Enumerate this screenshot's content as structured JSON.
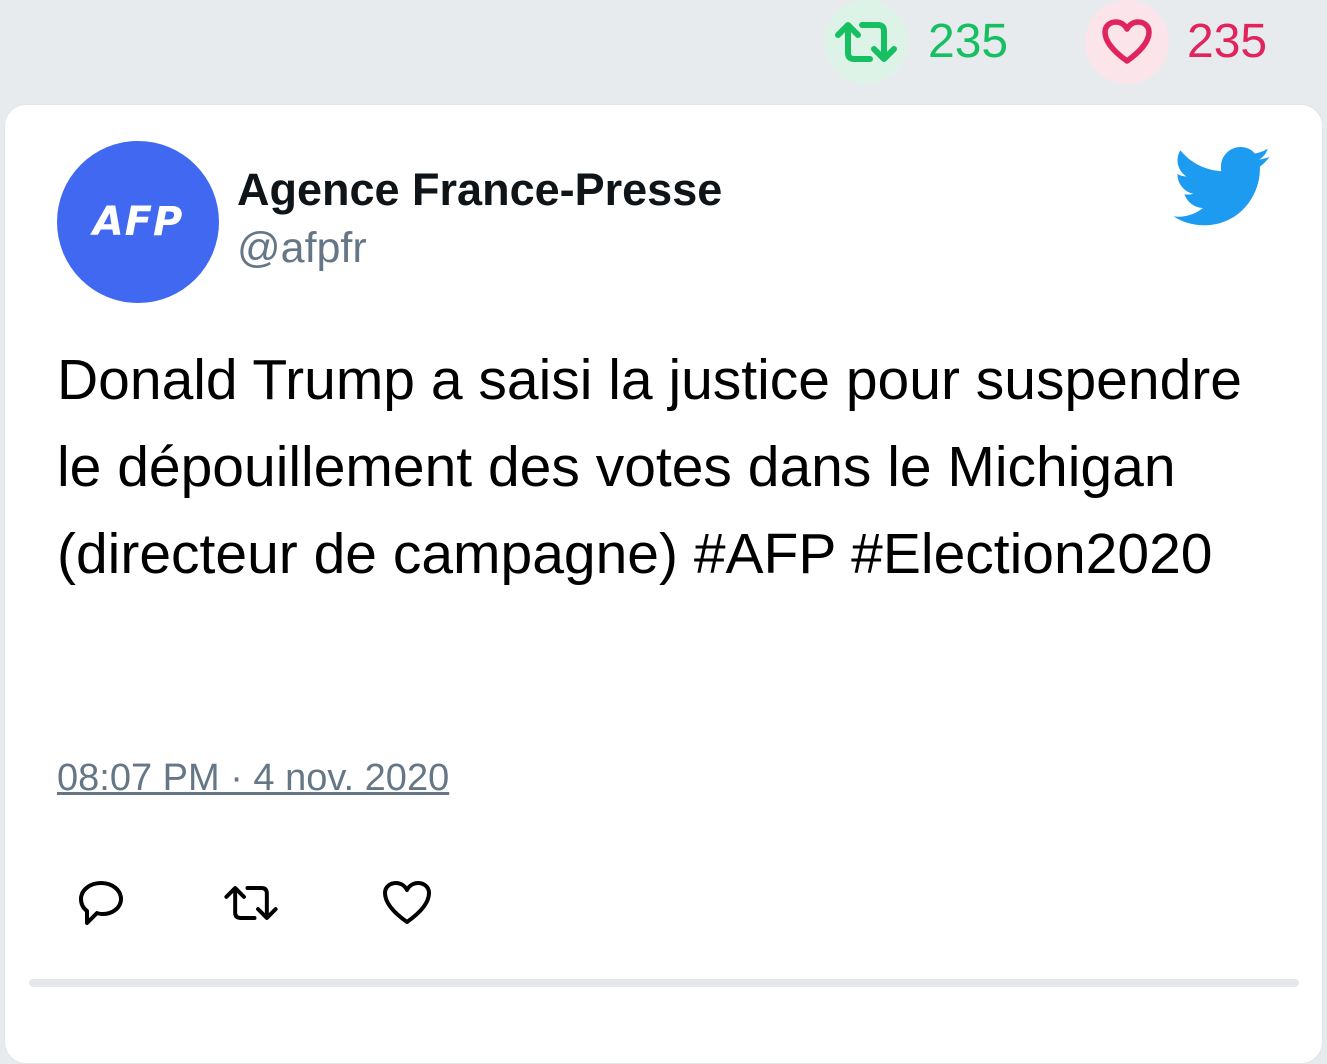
{
  "stats": {
    "retweets": {
      "count": "235",
      "icon": "retweet-icon",
      "color": "#17bf63"
    },
    "likes": {
      "count": "235",
      "icon": "heart-icon",
      "color": "#e0245e"
    }
  },
  "tweet": {
    "author": {
      "avatar_text": "AFP",
      "avatar_color": "#4168f0",
      "display_name": "Agence France-Presse",
      "handle": "@afpfr"
    },
    "brand_icon": "twitter-bird-icon",
    "text": "Donald Trump a saisi la justice pour suspendre le dépouillement des votes dans le Michigan (directeur de campagne) #AFP #Election2020",
    "timestamp": "08:07 PM · 4 nov. 2020",
    "actions": [
      {
        "name": "reply",
        "icon": "reply-icon"
      },
      {
        "name": "retweet",
        "icon": "retweet-icon"
      },
      {
        "name": "like",
        "icon": "heart-icon"
      }
    ]
  }
}
